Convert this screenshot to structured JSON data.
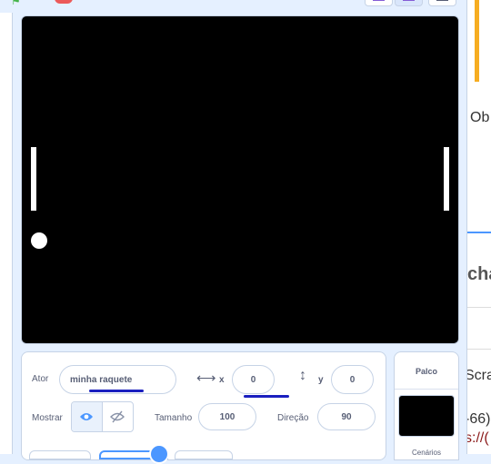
{
  "stage_panel": {
    "title": "Palco",
    "backdrops_label": "Cenários"
  },
  "sprite_info": {
    "sprite_label": "Ator",
    "sprite_name": "minha raquete",
    "x_label": "x",
    "x_value": "0",
    "y_label": "y",
    "y_value": "0",
    "show_label": "Mostrar",
    "size_label": "Tamanho",
    "size_value": "100",
    "direction_label": "Direção",
    "direction_value": "90"
  },
  "right_pane": {
    "text1": "Ob",
    "text2": "cha",
    "text3": "Scra",
    "text4": "-66)",
    "text5": "s://("
  },
  "colors": {
    "accent": "#4c97ff",
    "stage_bg": "#000000",
    "page_bg": "#e5f0ff",
    "underline": "#1a1fbf"
  }
}
